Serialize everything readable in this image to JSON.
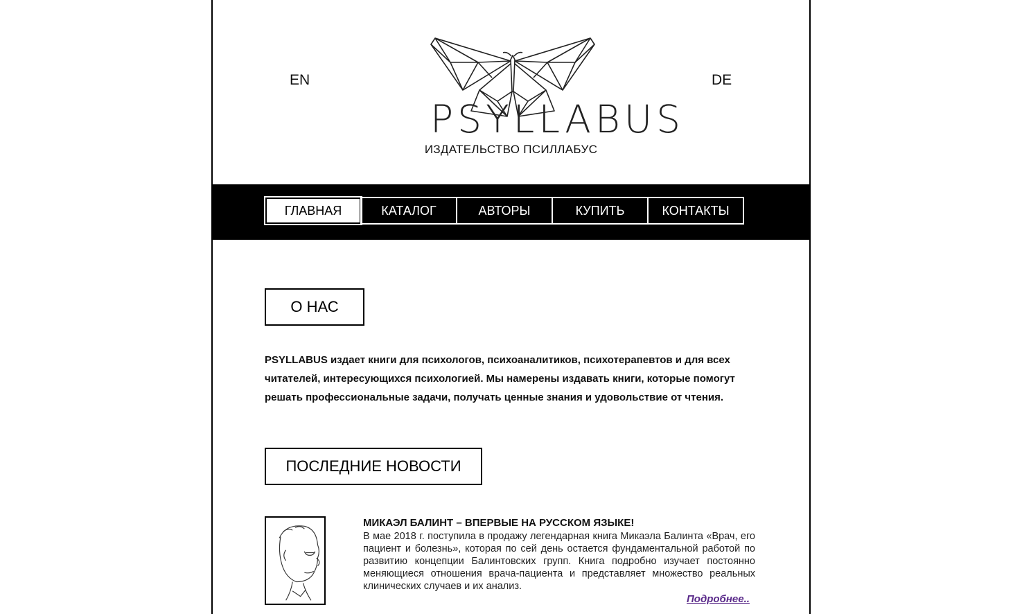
{
  "header": {
    "lang_en": "EN",
    "lang_de": "DE",
    "brand": "PSYLLABUS",
    "subtitle": "ИЗДАТЕЛЬСТВО ПСИЛЛАБУС",
    "logo_icon": "butterfly-logo-icon"
  },
  "nav": {
    "items": [
      {
        "label": "ГЛАВНАЯ",
        "active": true
      },
      {
        "label": "КАТАЛОГ"
      },
      {
        "label": "АВТОРЫ"
      },
      {
        "label": "КУПИТЬ"
      },
      {
        "label": "КОНТАКТЫ"
      }
    ]
  },
  "about": {
    "heading": "О НАС",
    "text": "PSYLLABUS издает книги для психологов, психоаналитиков, психотерапевтов и для всех читателей, интересующихся психологией.  Мы намерены издавать книги, которые помогут решать профессиональные задачи, получать ценные знания и удовольствие от чтения."
  },
  "news": {
    "heading": "ПОСЛЕДНИЕ НОВОСТИ",
    "items": [
      {
        "title": "МИКАЭЛ БАЛИНТ – ВПЕРВЫЕ НА РУССКОМ ЯЗЫКЕ!",
        "text": "В мае 2018 г. поступила в продажу легендарная книга Микаэла Балинта «Врач, его пациент и болезнь», которая по сей день остается фундаментальной работой по развитию концепции Балинтовских групп. Книга подробно изучает постоянно меняющиеся отношения врача-пациента и представляет множество реальных клинических случаев и их анализ.",
        "more": "Подробнее.."
      }
    ]
  },
  "colors": {
    "navbar_bg": "#000000",
    "link_visited": "#5a2a8a"
  }
}
